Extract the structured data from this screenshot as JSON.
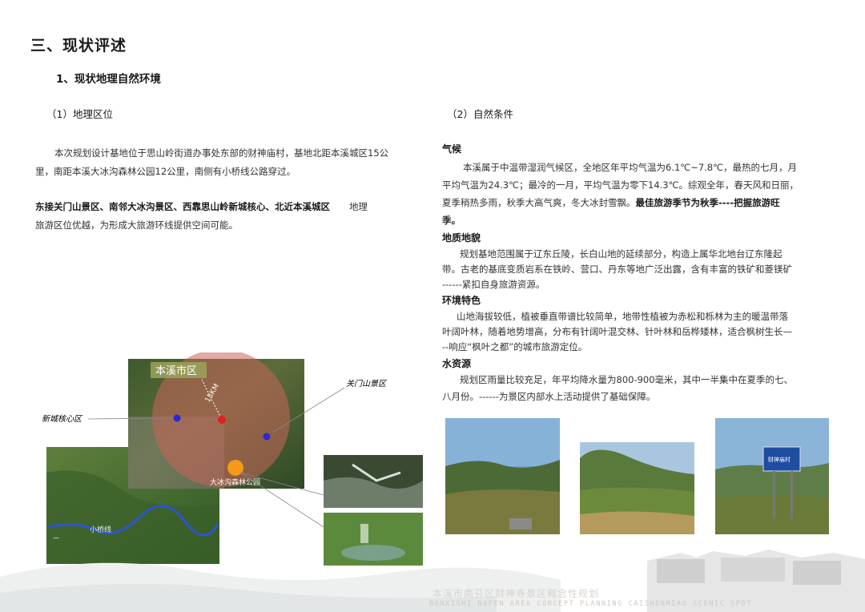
{
  "section_title": "三、现状评述",
  "subsection_title": "1、现状地理自然环境",
  "left": {
    "heading": "（1）地理区位",
    "paragraph1_line1": "本次规划设计基地位于思山岭街道办事处东部的财神庙村，基地北距本溪城区15公",
    "paragraph1_line2": "里，南距本溪大冰沟森林公园12公里，南侧有小桥线公路穿过。",
    "paragraph2_bold": "东接关门山景区、南邻大冰沟景区、西靠思山岭新城核心、北近本溪城区",
    "paragraph2_tail": "地理",
    "paragraph2_line2": "旅游区位优越，为形成大旅游环线提供空间可能。"
  },
  "right": {
    "heading": "（2）自然条件",
    "climate_title": "气候",
    "climate_l1": "本溪属于中温带湿润气候区，全地区年平均气温为6.1℃~7.8℃，最热的七月，月",
    "climate_l2": "平均气温为24.3℃；最冷的一月，平均气温为零下14.3℃。综观全年，春天风和日丽，",
    "climate_l3_normal": "夏季稍热多雨，秋季大高气爽，冬大冰封雪飘。",
    "climate_l3_bold": "最佳旅游季节为秋季----把握旅游旺",
    "climate_l4_bold": "季。",
    "geo_title": "地质地貌",
    "geo_l1": "规划基地范围属于辽东丘陵，长白山地的延续部分，构造上属华北地台辽东隆起",
    "geo_l2": "带。古老的基底变质岩系在铁岭、营口、丹东等地广泛出露，含有丰富的铁矿和菱镁矿",
    "geo_l3": "------紧扣自身旅游资源。",
    "env_title": "环境特色",
    "env_l1": "山地海拔较低，植被垂直带谱比较简单，地带性植被为赤松和栎林为主的暖温带落",
    "env_l2": "叶阔叶林，随着地势增高，分布有针阔叶混交林、针叶林和岳桦矮林，适合枫树生长—",
    "env_l3": "--响应“枫叶之都”的城市旅游定位。",
    "water_title": "水资源",
    "water_l1": "规划区雨量比较充足，年平均降水量为800-900毫米，其中一半集中在夏季的七、",
    "water_l2": "八月份。------为景区内部水上活动提供了基础保障。"
  },
  "map": {
    "city_label": "本溪市区",
    "distance_label": "15KM",
    "guanmen_label": "关门山景区",
    "xincheng_label": "新城核心区",
    "dabinggou_label": "大冰沟森林公园",
    "road_label": "小桥线"
  },
  "sign_text": "财神庙村",
  "footer": {
    "cn": "本溪市南芬区财神寺景区概念性规划",
    "en": "BENXISHI NAFEN AREA CONCEPT PLANNING CAISHENMIAO SCENIC SPOT"
  }
}
